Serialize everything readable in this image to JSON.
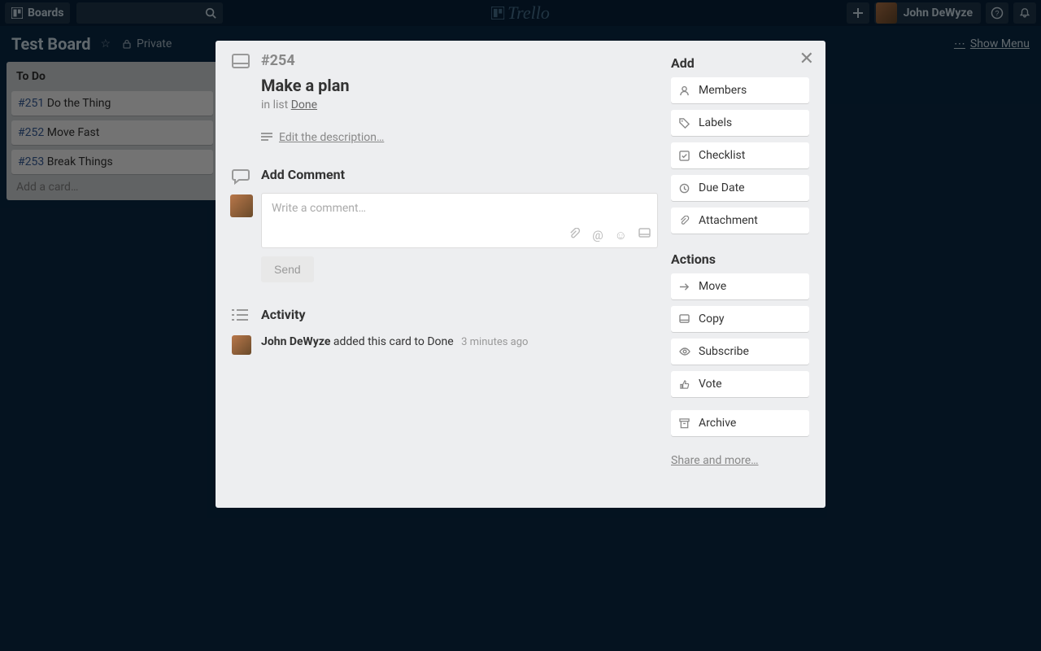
{
  "header": {
    "boards_label": "Boards",
    "user_name": "John DeWyze",
    "logo_text": "Trello"
  },
  "board": {
    "title": "Test Board",
    "privacy": "Private",
    "show_menu": "Show Menu"
  },
  "list": {
    "title": "To Do",
    "cards": [
      {
        "num": "#251",
        "text": "Do the Thing"
      },
      {
        "num": "#252",
        "text": "Move Fast"
      },
      {
        "num": "#253",
        "text": "Break Things"
      }
    ],
    "add_card": "Add a card…"
  },
  "dialog": {
    "card_num": "#254",
    "card_title": "Make a plan",
    "in_list_prefix": "in list ",
    "in_list_name": "Done",
    "edit_desc": "Edit the description…",
    "add_comment_h": "Add Comment",
    "comment_placeholder": "Write a comment…",
    "send": "Send",
    "activity_h": "Activity",
    "activity": {
      "who": "John DeWyze",
      "text": " added this card to Done",
      "when": "3 minutes ago"
    },
    "sidebar": {
      "add_h": "Add",
      "add_btns": [
        "Members",
        "Labels",
        "Checklist",
        "Due Date",
        "Attachment"
      ],
      "actions_h": "Actions",
      "action_btns": [
        "Move",
        "Copy",
        "Subscribe",
        "Vote",
        "Archive"
      ],
      "share": "Share and more…"
    }
  }
}
